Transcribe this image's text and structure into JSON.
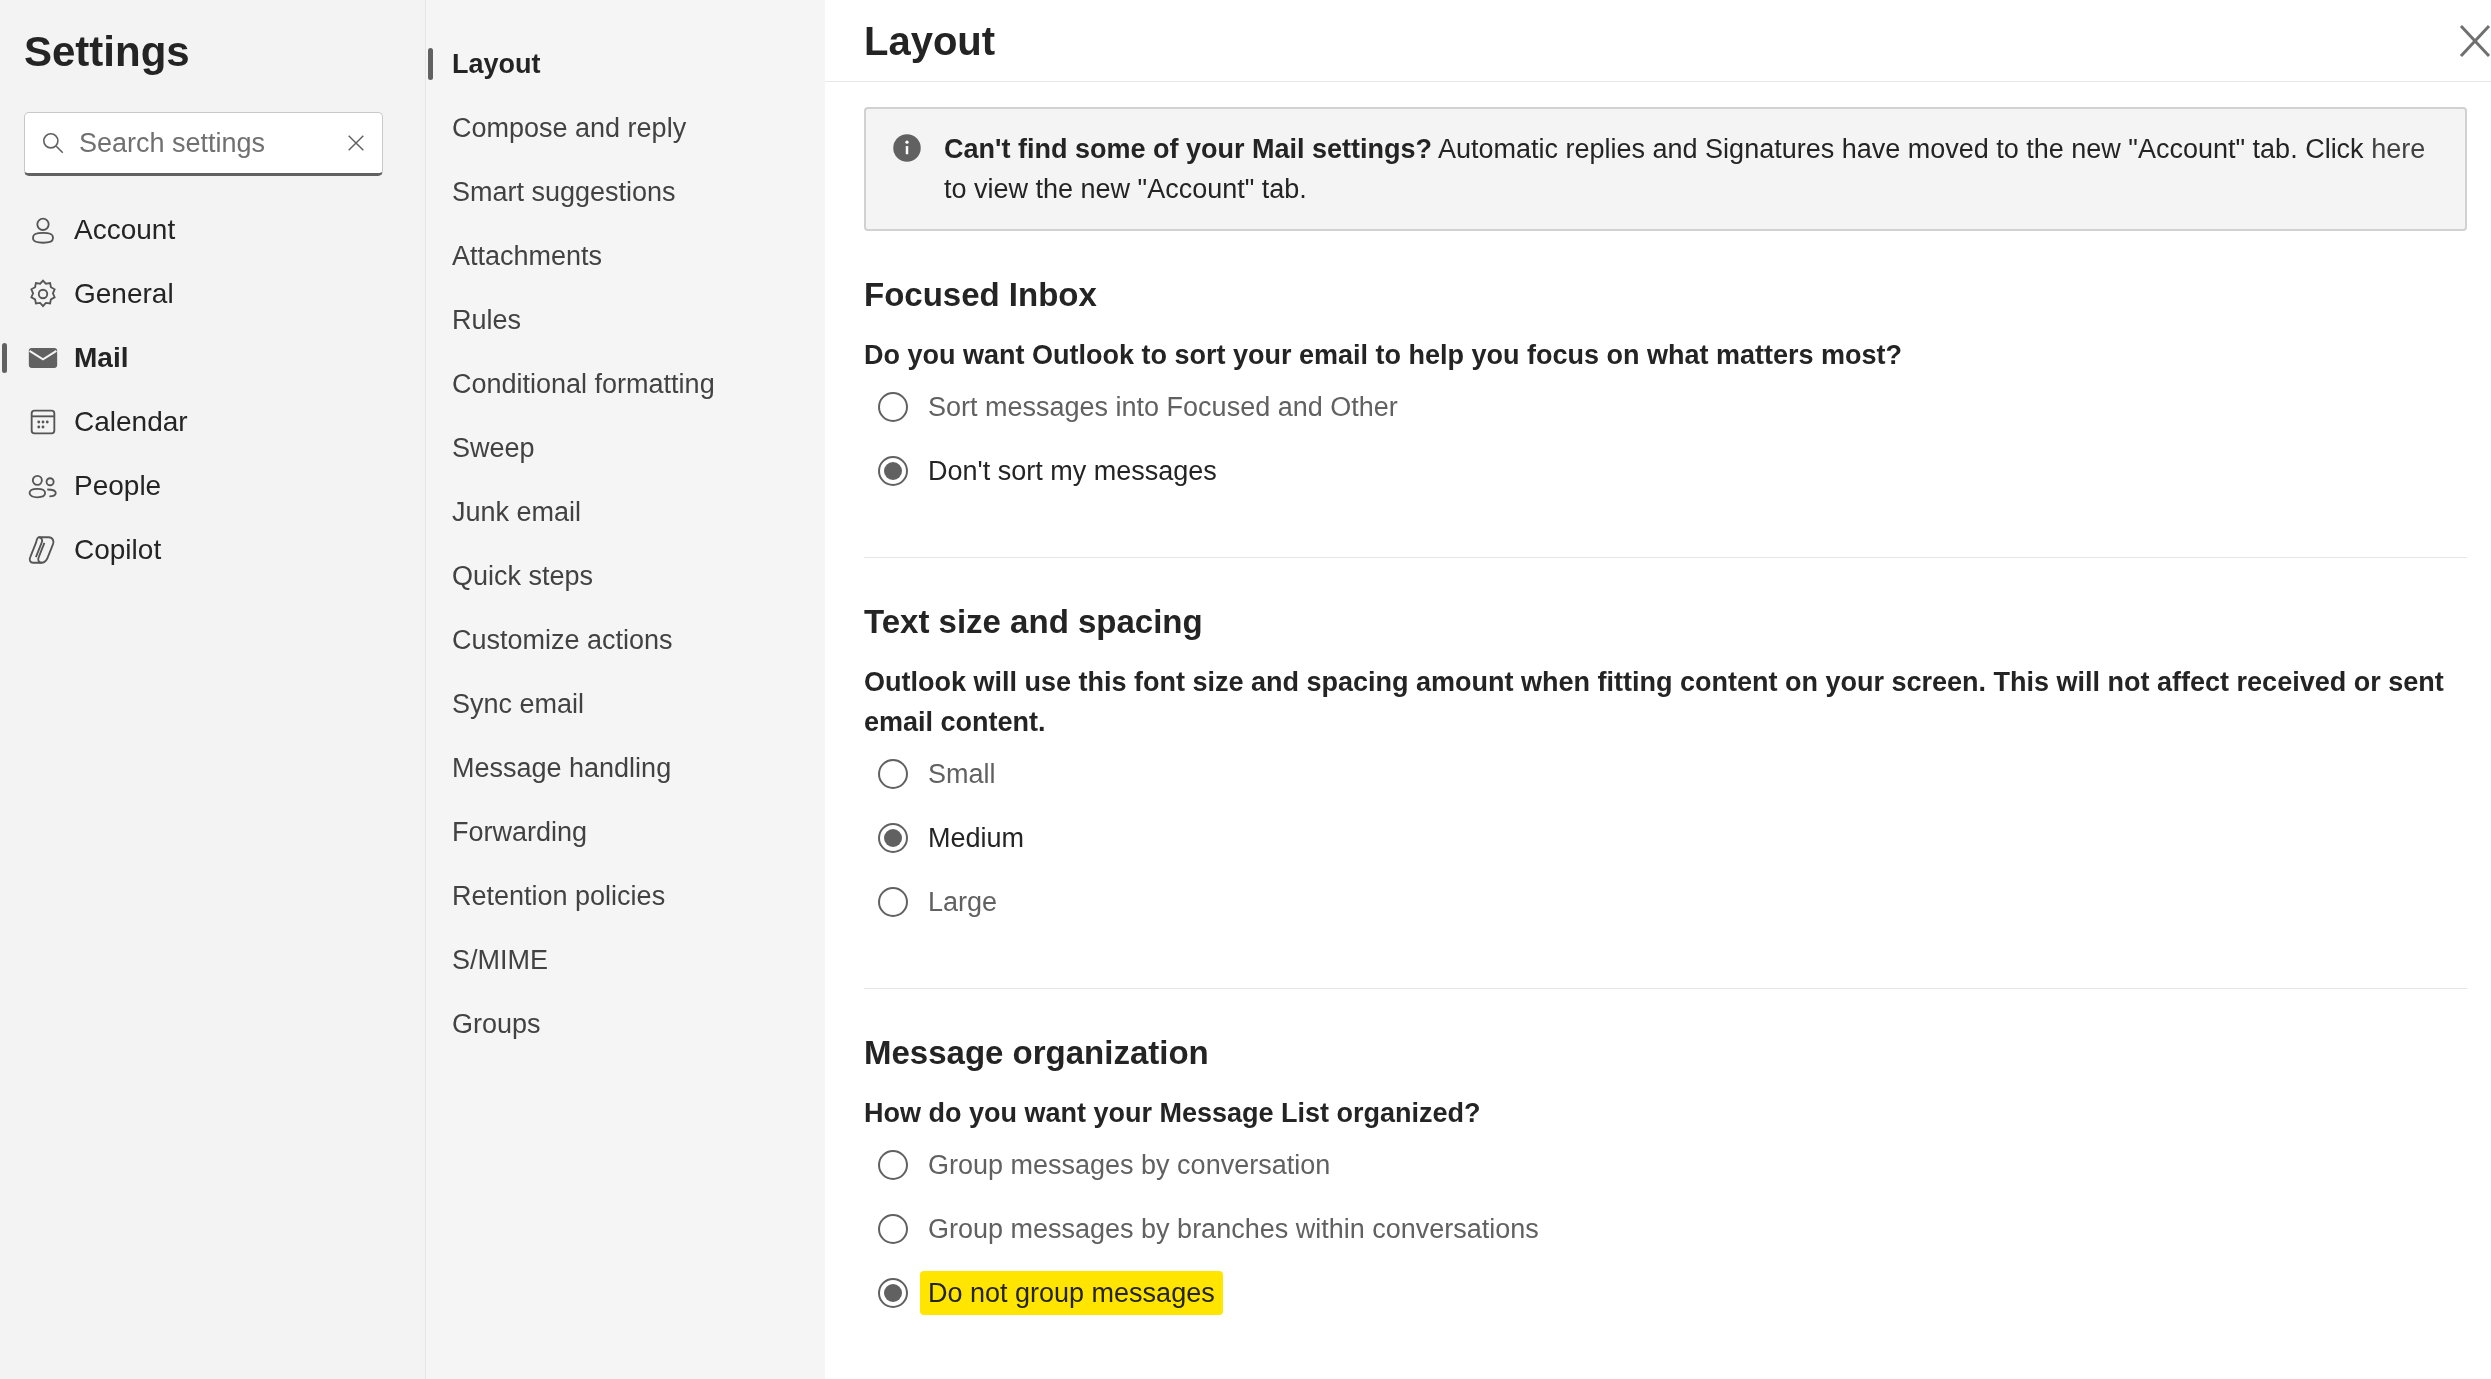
{
  "sidebar": {
    "title": "Settings",
    "search": {
      "placeholder": "Search settings"
    },
    "items": [
      {
        "label": "Account",
        "selected": false
      },
      {
        "label": "General",
        "selected": false
      },
      {
        "label": "Mail",
        "selected": true
      },
      {
        "label": "Calendar",
        "selected": false
      },
      {
        "label": "People",
        "selected": false
      },
      {
        "label": "Copilot",
        "selected": false
      }
    ]
  },
  "subnav": {
    "items": [
      {
        "label": "Layout",
        "selected": true
      },
      {
        "label": "Compose and reply",
        "selected": false
      },
      {
        "label": "Smart suggestions",
        "selected": false
      },
      {
        "label": "Attachments",
        "selected": false
      },
      {
        "label": "Rules",
        "selected": false
      },
      {
        "label": "Conditional formatting",
        "selected": false
      },
      {
        "label": "Sweep",
        "selected": false
      },
      {
        "label": "Junk email",
        "selected": false
      },
      {
        "label": "Quick steps",
        "selected": false
      },
      {
        "label": "Customize actions",
        "selected": false
      },
      {
        "label": "Sync email",
        "selected": false
      },
      {
        "label": "Message handling",
        "selected": false
      },
      {
        "label": "Forwarding",
        "selected": false
      },
      {
        "label": "Retention policies",
        "selected": false
      },
      {
        "label": "S/MIME",
        "selected": false
      },
      {
        "label": "Groups",
        "selected": false
      }
    ]
  },
  "panel": {
    "title": "Layout",
    "notice": {
      "bold": "Can't find some of your Mail settings?",
      "text": " Automatic replies and Signatures have moved to the new \"Account\" tab. Click ",
      "link": "here",
      "after": " to view the new \"Account\" tab."
    },
    "sections": [
      {
        "heading": "Focused Inbox",
        "question": "Do you want Outlook to sort your email to help you focus on what matters most?",
        "options": [
          {
            "label": "Sort messages into Focused and Other",
            "selected": false,
            "highlighted": false
          },
          {
            "label": "Don't sort my messages",
            "selected": true,
            "highlighted": false
          }
        ]
      },
      {
        "heading": "Text size and spacing",
        "question": "Outlook will use this font size and spacing amount when fitting content on your screen. This will not affect received or sent email content.",
        "options": [
          {
            "label": "Small",
            "selected": false,
            "highlighted": false
          },
          {
            "label": "Medium",
            "selected": true,
            "highlighted": false
          },
          {
            "label": "Large",
            "selected": false,
            "highlighted": false
          }
        ]
      },
      {
        "heading": "Message organization",
        "question": "How do you want your Message List organized?",
        "options": [
          {
            "label": "Group messages by conversation",
            "selected": false,
            "highlighted": false
          },
          {
            "label": "Group messages by branches within conversations",
            "selected": false,
            "highlighted": false
          },
          {
            "label": "Do not group messages",
            "selected": true,
            "highlighted": true
          }
        ]
      }
    ]
  }
}
